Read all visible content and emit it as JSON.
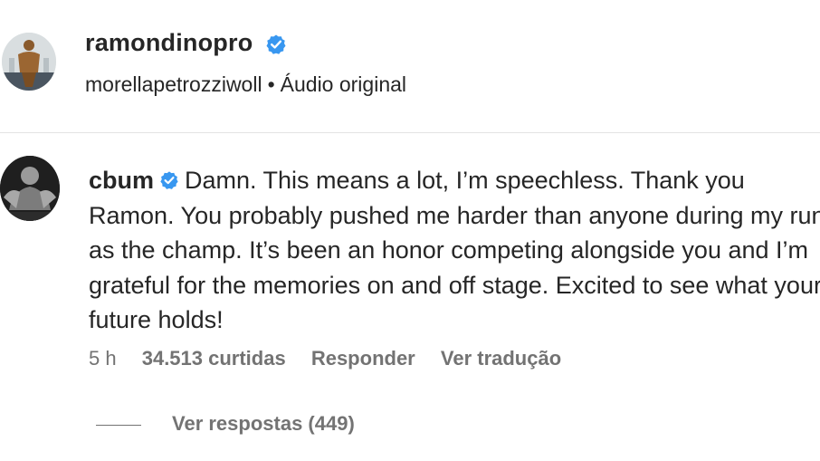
{
  "post": {
    "username": "ramondinopro",
    "audio_author": "morellapetrozziwoll",
    "separator": "•",
    "audio_label": "Áudio original",
    "avatar_icon": "avatar-photo"
  },
  "comment": {
    "username": "cbum",
    "text": "Damn. This means a lot, I’m speechless. Thank you Ramon. You probably pushed me harder than anyone during my run as the champ. It’s been an honor competing alongside you and I’m grateful for the memories on and off stage. Excited to see what your future holds!",
    "time": "5 h",
    "likes": "34.513 curtidas",
    "reply_label": "Responder",
    "translate_label": "Ver tradução",
    "view_replies_label": "Ver respostas (449)"
  },
  "colors": {
    "verified_badge": "#3897f0",
    "primary_text": "#262626",
    "secondary_text": "#737373",
    "divider": "#e3e3e3"
  }
}
